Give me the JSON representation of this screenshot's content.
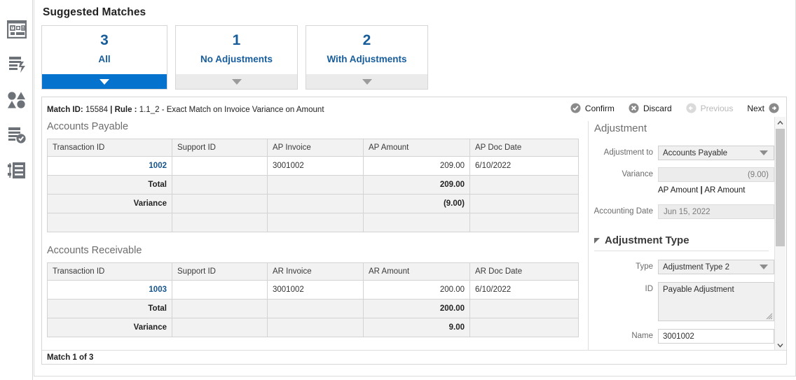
{
  "sidebar": {
    "items": [
      {
        "icon": "dashboard-icon",
        "name": "sidebar-item-dashboard"
      },
      {
        "icon": "document-lightning-icon",
        "name": "sidebar-item-auto-match"
      },
      {
        "icon": "shapes-icon",
        "name": "sidebar-item-shapes"
      },
      {
        "icon": "document-check-icon",
        "name": "sidebar-item-approved"
      },
      {
        "icon": "ledger-list-icon",
        "name": "sidebar-item-ledger"
      }
    ]
  },
  "header": {
    "title": "Suggested Matches"
  },
  "tabs": [
    {
      "count": "3",
      "label": "All",
      "active": true
    },
    {
      "count": "1",
      "label": "No Adjustments",
      "active": false
    },
    {
      "count": "2",
      "label": "With Adjustments",
      "active": false
    }
  ],
  "meta": {
    "match_id_label": "Match ID:",
    "match_id_value": "15584",
    "separator": "|",
    "rule_label": "Rule :",
    "rule_value": "1.1_2 - Exact Match on Invoice Variance on Amount"
  },
  "toolbar": {
    "confirm_label": "Confirm",
    "discard_label": "Discard",
    "previous_label": "Previous",
    "next_label": "Next"
  },
  "accounts_payable": {
    "title": "Accounts Payable",
    "columns": [
      "Transaction ID",
      "Support ID",
      "AP Invoice",
      "AP Amount",
      "AP Doc Date"
    ],
    "rows": [
      {
        "transaction_id": "1002",
        "support_id": "",
        "invoice": "3001002",
        "amount": "209.00",
        "doc_date": "6/10/2022"
      }
    ],
    "total": {
      "label": "Total",
      "amount": "209.00"
    },
    "variance": {
      "label": "Variance",
      "amount": "(9.00)"
    }
  },
  "accounts_receivable": {
    "title": "Accounts Receivable",
    "columns": [
      "Transaction ID",
      "Support ID",
      "AR Invoice",
      "AR Amount",
      "AR Doc Date"
    ],
    "rows": [
      {
        "transaction_id": "1003",
        "support_id": "",
        "invoice": "3001002",
        "amount": "200.00",
        "doc_date": "6/10/2022"
      }
    ],
    "total": {
      "label": "Total",
      "amount": "200.00"
    },
    "variance": {
      "label": "Variance",
      "amount": "9.00"
    }
  },
  "adjustment": {
    "heading": "Adjustment",
    "adjustment_to_label": "Adjustment to",
    "adjustment_to_value": "Accounts Payable",
    "variance_label": "Variance",
    "variance_value": "(9.00)",
    "amount_link_1": "AP Amount",
    "amount_link_sep": "|",
    "amount_link_2": "AR Amount",
    "accounting_date_label": "Accounting Date",
    "accounting_date_value": "Jun 15, 2022"
  },
  "adjustment_type": {
    "heading": "Adjustment Type",
    "type_label": "Type",
    "type_value": "Adjustment Type 2",
    "id_label": "ID",
    "id_value": "Payable Adjustment",
    "name_label": "Name",
    "name_value": "3001002"
  },
  "status": {
    "text": "Match 1 of 3"
  },
  "colors": {
    "accent_blue": "#0572ce",
    "link_blue": "#175d9c",
    "header_gray": "#f2f2f2",
    "border_gray": "#d3d3d3",
    "icon_gray": "#6d7278"
  }
}
